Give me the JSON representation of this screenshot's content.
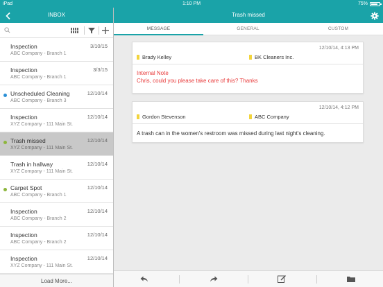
{
  "status_bar": {
    "carrier": "iPad",
    "time": "1:10 PM",
    "battery": "75%"
  },
  "left_nav": {
    "title": "INBOX"
  },
  "right_nav": {
    "title": "Trash missed"
  },
  "search": {
    "placeholder": ""
  },
  "inbox": {
    "items": [
      {
        "title": "Inspection",
        "subtitle": "ABC Company - Branch 1",
        "date": "3/10/15",
        "dot": ""
      },
      {
        "title": "Inspection",
        "subtitle": "ABC Company - Branch 1",
        "date": "3/3/15",
        "dot": ""
      },
      {
        "title": "Unscheduled Cleaning",
        "subtitle": "ABC Company - Branch 3",
        "date": "12/10/14",
        "dot": "#2a8fd6"
      },
      {
        "title": "Inspection",
        "subtitle": "XYZ Company - 111 Main St.",
        "date": "12/10/14",
        "dot": ""
      },
      {
        "title": "Trash missed",
        "subtitle": "XYZ Company - 111 Main St.",
        "date": "12/10/14",
        "dot": "#8db63c"
      },
      {
        "title": "Trash in hallway",
        "subtitle": "XYZ Company - 111 Main St.",
        "date": "12/10/14",
        "dot": ""
      },
      {
        "title": "Carpet Spot",
        "subtitle": "ABC Company - Branch 1",
        "date": "12/10/14",
        "dot": "#8db63c"
      },
      {
        "title": "Inspection",
        "subtitle": "ABC Company - Branch 2",
        "date": "12/10/14",
        "dot": ""
      },
      {
        "title": "Inspection",
        "subtitle": "ABC Company - Branch 2",
        "date": "12/10/14",
        "dot": ""
      },
      {
        "title": "Inspection",
        "subtitle": "XYZ Company - 111 Main St.",
        "date": "12/10/14",
        "dot": ""
      }
    ],
    "load_more": "Load More..."
  },
  "tabs": {
    "message": "MESSAGE",
    "general": "GENERAL",
    "custom": "CUSTOM"
  },
  "messages": [
    {
      "date": "12/10/14, 4:13 PM",
      "from": "Brady Kelley",
      "to": "BK Cleaners Inc.",
      "label": "Internal Note",
      "body": "Chris, could you please take care of this? Thanks"
    },
    {
      "date": "12/10/14, 4:12 PM",
      "from": "Gordon Stevenson",
      "to": "ABC Company",
      "body": "A trash can in the women's restroom was missed during last night's cleaning."
    }
  ],
  "colors": {
    "accent": "#1aa3a8",
    "dot_blue": "#2a8fd6",
    "dot_green": "#8db63c",
    "tag_yellow": "#f2d43c",
    "note_red": "#e83a3a"
  },
  "icons": {
    "back": "chevron-left-icon",
    "settings": "gear-icon",
    "search": "search-icon",
    "grid": "grid-icon",
    "filter": "filter-icon",
    "add": "plus-icon",
    "reply": "reply-icon",
    "forward": "forward-icon",
    "compose": "compose-icon",
    "folder": "folder-icon"
  }
}
